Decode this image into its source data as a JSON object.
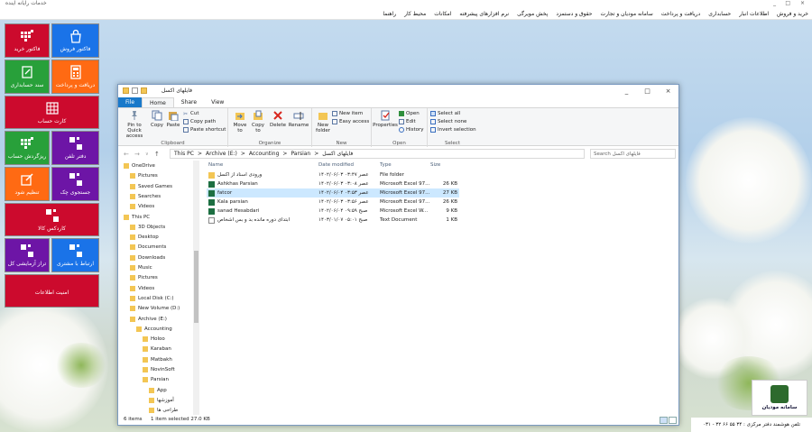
{
  "app": {
    "title": "خدمات رایانه آینده",
    "window_controls": [
      "_",
      "□",
      "×"
    ]
  },
  "menu": [
    "خرید و فروش",
    "اطلاعات انبار",
    "حسابداری",
    "دریافت و پرداخت",
    "سامانه مودیان و تجارت",
    "حقوق و دستمزد",
    "پخش مویرگی",
    "نرم افزارهای پیشرفته",
    "امکانات",
    "محیط کار",
    "راهنما"
  ],
  "tiles": {
    "invoice_buy": "فاکتور خرید",
    "invoice_sell": "فاکتور فروش",
    "accounting_doc": "سند حسابداری",
    "receive_pay": "دریافت و پرداخت",
    "account_card": "کارت حساب",
    "ledger": "ریزگردش حساب",
    "person_book": "دفتر تلفن",
    "settings": "تنظیم شود",
    "check_search": "جستجوی چک",
    "kardex": "کاردکس کالا",
    "trial_balance": "تراز آزمایشی کل",
    "customer_contact": "ارتباط با مشتری",
    "data_security": "امنیت اطلاعات"
  },
  "explorer": {
    "title": "فایلهای اکسل",
    "tabs": [
      "File",
      "Home",
      "Share",
      "View"
    ],
    "ribbon": {
      "clipboard": {
        "label": "Clipboard",
        "pin": "Pin to Quick access",
        "copy": "Copy",
        "paste": "Paste",
        "cut": "Cut",
        "copy_path": "Copy path",
        "paste_shortcut": "Paste shortcut"
      },
      "organize": {
        "label": "Organize",
        "move_to": "Move to",
        "copy_to": "Copy to",
        "delete": "Delete",
        "rename": "Rename"
      },
      "new": {
        "label": "New",
        "new_folder": "New folder",
        "new_item": "New item",
        "easy_access": "Easy access"
      },
      "open": {
        "label": "Open",
        "properties": "Properties",
        "open": "Open",
        "edit": "Edit",
        "history": "History"
      },
      "select": {
        "label": "Select",
        "select_all": "Select all",
        "select_none": "Select none",
        "invert": "Invert selection"
      }
    },
    "address": [
      "This PC",
      ">",
      "Archive (E:)",
      ">",
      "Accounting",
      ">",
      "Parsian",
      ">",
      "فایلهای اکسل"
    ],
    "search_placeholder": "Search فایلهای اکسل",
    "nav": [
      {
        "label": "OneDrive",
        "indent": 0
      },
      {
        "label": "Pictures",
        "indent": 1
      },
      {
        "label": "Saved Games",
        "indent": 1
      },
      {
        "label": "Searches",
        "indent": 1
      },
      {
        "label": "Videos",
        "indent": 1
      },
      {
        "label": "This PC",
        "indent": 0
      },
      {
        "label": "3D Objects",
        "indent": 1
      },
      {
        "label": "Desktop",
        "indent": 1
      },
      {
        "label": "Documents",
        "indent": 1
      },
      {
        "label": "Downloads",
        "indent": 1
      },
      {
        "label": "Music",
        "indent": 1
      },
      {
        "label": "Pictures",
        "indent": 1
      },
      {
        "label": "Videos",
        "indent": 1
      },
      {
        "label": "Local Disk (C:)",
        "indent": 1
      },
      {
        "label": "New Volume (D:)",
        "indent": 1
      },
      {
        "label": "Archive (E:)",
        "indent": 1
      },
      {
        "label": "Accounting",
        "indent": 2
      },
      {
        "label": "Holoo",
        "indent": 3
      },
      {
        "label": "Karaban",
        "indent": 3
      },
      {
        "label": "Matbakh",
        "indent": 3
      },
      {
        "label": "NovinSoft",
        "indent": 3
      },
      {
        "label": "Parsian",
        "indent": 3
      },
      {
        "label": "App",
        "indent": 4
      },
      {
        "label": "آموزشها",
        "indent": 4
      },
      {
        "label": "طراحی ها",
        "indent": 4
      }
    ],
    "columns": {
      "name": "Name",
      "date": "Date modified",
      "type": "Type",
      "size": "Size"
    },
    "files": [
      {
        "name": "ورودی اسناد از اکسل",
        "date": "۱۴۰۲/۰۶/۰۳ عصر ۰۳:۴۷",
        "type": "File folder",
        "size": "",
        "kind": "folder"
      },
      {
        "name": "Ashkhas Parsian",
        "date": "۱۴۰۲/۰۶/۰۳ عصر ۰۳:۰۸",
        "type": "Microsoft Excel 97...",
        "size": "26 KB",
        "kind": "excel"
      },
      {
        "name": "fatcor",
        "date": "۱۴۰۲/۰۶/۰۴ عصر ۰۳:۵۳",
        "type": "Microsoft Excel 97...",
        "size": "27 KB",
        "kind": "excel"
      },
      {
        "name": "Kala parsian",
        "date": "۱۴۰۲/۰۶/۰۳ عصر ۰۳:۵۶",
        "type": "Microsoft Excel 97...",
        "size": "26 KB",
        "kind": "excel"
      },
      {
        "name": "sanad Hesabdari",
        "date": "۱۴۰۲/۰۶/۰۴ صبح ۰۹:۵۹",
        "type": "Microsoft Excel W...",
        "size": "9 KB",
        "kind": "excel"
      },
      {
        "name": "ابتدای دوره مانده بد و بس اشخاص",
        "date": "۱۴۰۳/۰۱/۰۷ صبح ۰۵:۰۱",
        "type": "Text Document",
        "size": "1 KB",
        "kind": "text"
      }
    ],
    "status_items": "6 items",
    "status_selected": "1 item selected  27.0 KB"
  },
  "logo_text": "سامانه مودیان",
  "bottom_text": "تلفن هوشمند دفتر مرکزی : ۳۴ ۵۵ ۶۶ ۳۲ - ۰۳۱",
  "colors": {
    "red": "#cc0a2d",
    "blue": "#1a73e8",
    "purple": "#6d15a6",
    "green": "#28a03a",
    "orange": "#ff6a13"
  }
}
